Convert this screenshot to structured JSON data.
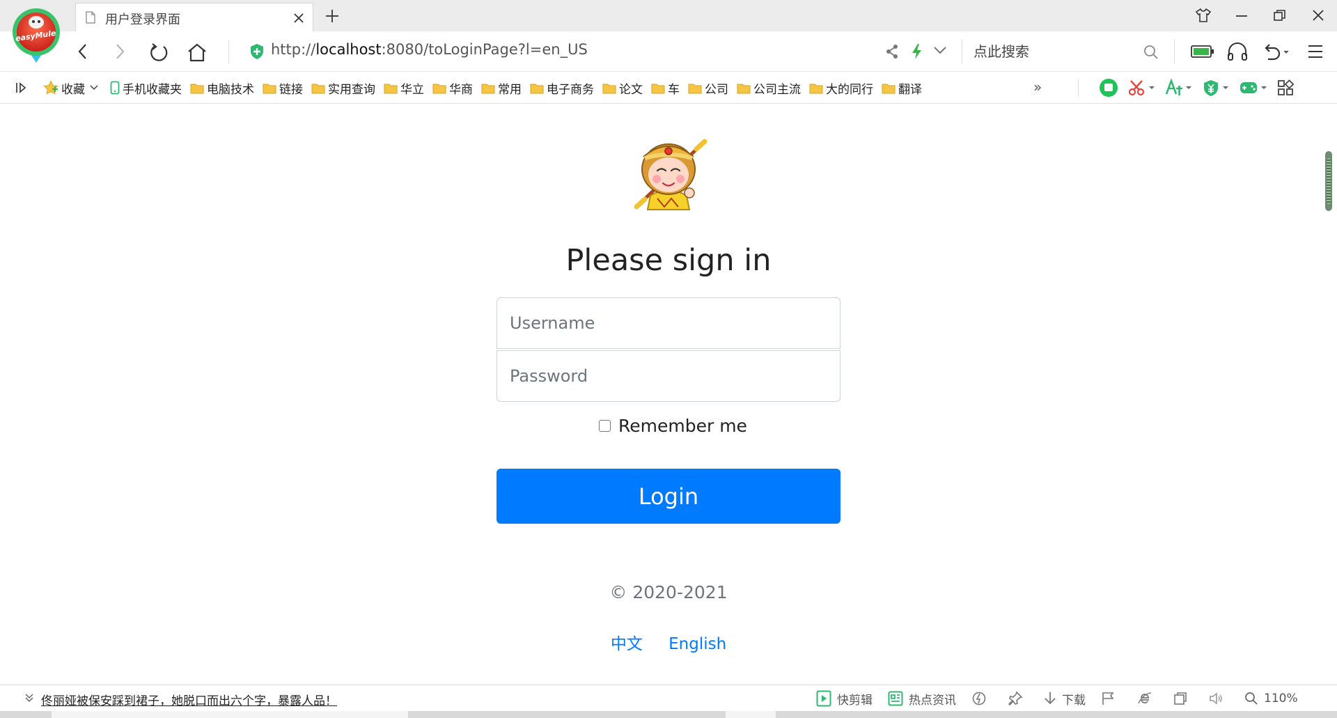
{
  "tab": {
    "title": "用户登录界面"
  },
  "logo": {
    "text": "easyMule"
  },
  "address": {
    "scheme": "http://",
    "host": "localhost",
    "rest": ":8080/toLoginPage?l=en_US"
  },
  "search": {
    "placeholder": "点此搜索"
  },
  "bookmarks": [
    {
      "label": "收藏",
      "icon": "star-icon"
    },
    {
      "label": "手机收藏夹",
      "icon": "phone-icon"
    },
    {
      "label": "电脑技术",
      "icon": "folder-icon"
    },
    {
      "label": "链接",
      "icon": "folder-icon"
    },
    {
      "label": "实用查询",
      "icon": "folder-icon"
    },
    {
      "label": "华立",
      "icon": "folder-icon"
    },
    {
      "label": "华商",
      "icon": "folder-icon"
    },
    {
      "label": "常用",
      "icon": "folder-icon"
    },
    {
      "label": "电子商务",
      "icon": "folder-icon"
    },
    {
      "label": "论文",
      "icon": "folder-icon"
    },
    {
      "label": "车",
      "icon": "folder-icon"
    },
    {
      "label": "公司",
      "icon": "folder-icon"
    },
    {
      "label": "公司主流",
      "icon": "folder-icon"
    },
    {
      "label": "大的同行",
      "icon": "folder-icon"
    },
    {
      "label": "翻译",
      "icon": "folder-icon"
    }
  ],
  "bookmarks_more": "»",
  "login": {
    "heading": "Please sign in",
    "username_placeholder": "Username",
    "password_placeholder": "Password",
    "remember_label": "Remember me",
    "remember_checked": false,
    "button_label": "Login",
    "copyright": "© 2020-2021",
    "lang_zh": "中文",
    "lang_en": "English"
  },
  "statusbar": {
    "news": "佟丽娅被保安踩到裙子，她脱口而出六个字，暴露人品！",
    "quick_edit": "快剪辑",
    "hot_news": "热点资讯",
    "download": "下载",
    "zoom": "110%"
  },
  "colors": {
    "primary": "#007bff",
    "muted_text": "#6c757d",
    "folder": "#f7c544",
    "shield": "#2eb872"
  }
}
